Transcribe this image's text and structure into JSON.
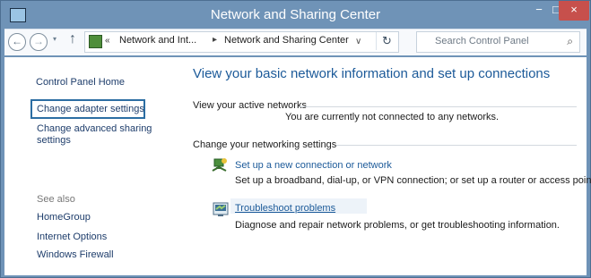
{
  "window": {
    "title": "Network and Sharing Center",
    "controls": {
      "minimize": "−",
      "maximize": "□",
      "close": "×"
    }
  },
  "navigation": {
    "back_icon": "back-arrow-icon",
    "forward_icon": "forward-arrow-icon",
    "recent_dropdown": "▾",
    "up": "↑",
    "address_prefix": "«",
    "breadcrumb": [
      "Network and Int...",
      "Network and Sharing Center"
    ],
    "crumb_separator": "▸",
    "address_dropdown": "∨",
    "refresh": "↻",
    "search_placeholder": "Search Control Panel",
    "search_icon": "⌕"
  },
  "sidebar": {
    "home": "Control Panel Home",
    "adapter_settings": "Change adapter settings",
    "advanced_settings": "Change advanced sharing settings",
    "see_also": "See also",
    "links": [
      "HomeGroup",
      "Internet Options",
      "Windows Firewall"
    ]
  },
  "main": {
    "title": "View your basic network information and set up connections",
    "active_networks_label": "View your active networks",
    "active_networks_status": "You are currently not connected to any networks.",
    "settings_label": "Change your networking settings",
    "tasks": [
      {
        "icon": "network-setup-icon",
        "link": "Set up a new connection or network",
        "description": "Set up a broadband, dial-up, or VPN connection; or set up a router or access point."
      },
      {
        "icon": "troubleshoot-icon",
        "link": "Troubleshoot problems",
        "description": "Diagnose and repair network problems, or get troubleshooting information."
      }
    ]
  },
  "colors": {
    "title_bar": "#6f93b7",
    "link": "#1c5a99",
    "selection_outline": "#2c6ea3",
    "close_button": "#c7504c"
  }
}
